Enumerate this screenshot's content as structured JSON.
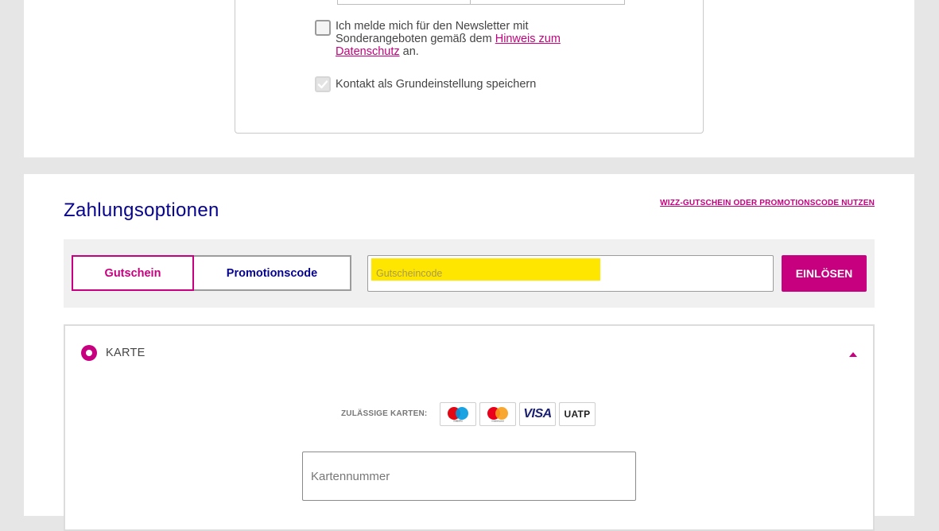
{
  "contact": {
    "newsletter": {
      "text_before": "Ich melde mich für den Newsletter mit Sonderangeboten gemäß dem ",
      "link": "Hinweis zum Datenschutz",
      "text_after": " an.",
      "checked": false
    },
    "save_default": {
      "label": "Kontakt als Grundeinstellung speichern",
      "checked": true
    }
  },
  "payment": {
    "title": "Zahlungsoptionen",
    "promo_link": "WIZZ-GUTSCHEIN ODER PROMOTIONSCODE NUTZEN",
    "tabs": [
      {
        "label": "Gutschein",
        "active": true
      },
      {
        "label": "Promotionscode",
        "active": false
      }
    ],
    "voucher_placeholder": "Gutscheincode",
    "redeem_button": "EINLÖSEN",
    "card": {
      "label": "KARTE",
      "accepted_label": "ZULÄSSIGE KARTEN:",
      "logos": [
        {
          "name": "maestro-icon",
          "caption": "maestro"
        },
        {
          "name": "mastercard-icon",
          "caption": "mastercard"
        },
        {
          "name": "visa-icon",
          "text": "VISA"
        },
        {
          "name": "uatp-icon",
          "text": "UATP"
        }
      ],
      "number_placeholder": "Kartennummer"
    }
  },
  "colors": {
    "accent": "#c6007e",
    "navy": "#06038d",
    "highlight": "#ffe600"
  }
}
